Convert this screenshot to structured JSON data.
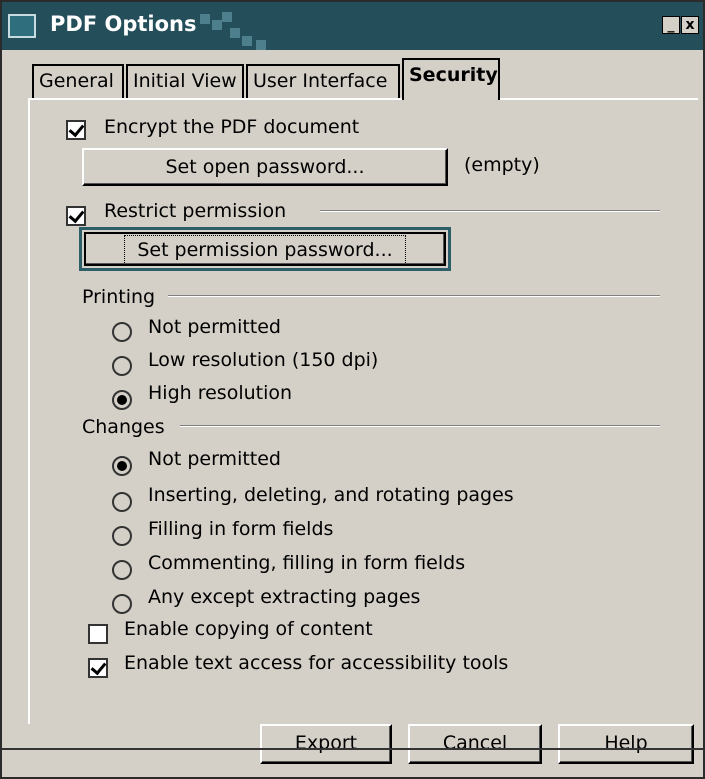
{
  "window": {
    "title": "PDF Options",
    "minimize_label": "_",
    "close_label": "x"
  },
  "tabs": [
    {
      "label": "General",
      "active": false
    },
    {
      "label": "Initial View",
      "active": false
    },
    {
      "label": "User Interface",
      "active": false
    },
    {
      "label": "Security",
      "active": true
    }
  ],
  "security": {
    "encrypt": {
      "label": "Encrypt the PDF document",
      "checked": true
    },
    "open_password_button": "Set open password...",
    "open_password_status": "(empty)",
    "restrict": {
      "label": "Restrict permission",
      "checked": true
    },
    "permission_password_button": "Set permission password...",
    "printing": {
      "heading": "Printing",
      "options": [
        {
          "label": "Not permitted",
          "checked": false
        },
        {
          "label": "Low resolution (150 dpi)",
          "checked": false
        },
        {
          "label": "High resolution",
          "checked": true
        }
      ]
    },
    "changes": {
      "heading": "Changes",
      "options": [
        {
          "label": "Not permitted",
          "checked": true
        },
        {
          "label": "Inserting, deleting, and rotating pages",
          "checked": false
        },
        {
          "label": "Filling in form fields",
          "checked": false
        },
        {
          "label": "Commenting, filling in form fields",
          "checked": false
        },
        {
          "label": "Any except extracting pages",
          "checked": false
        }
      ]
    },
    "copy_content": {
      "label": "Enable copying of content",
      "checked": false
    },
    "accessibility": {
      "label": "Enable text access for accessibility tools",
      "checked": true
    }
  },
  "buttons": {
    "export": "Export",
    "cancel": "Cancel",
    "help": "Help"
  },
  "colors": {
    "titlebar": "#234e5a",
    "dialog_bg": "#d4d0c8",
    "focus_ring": "#2c5f6a"
  }
}
